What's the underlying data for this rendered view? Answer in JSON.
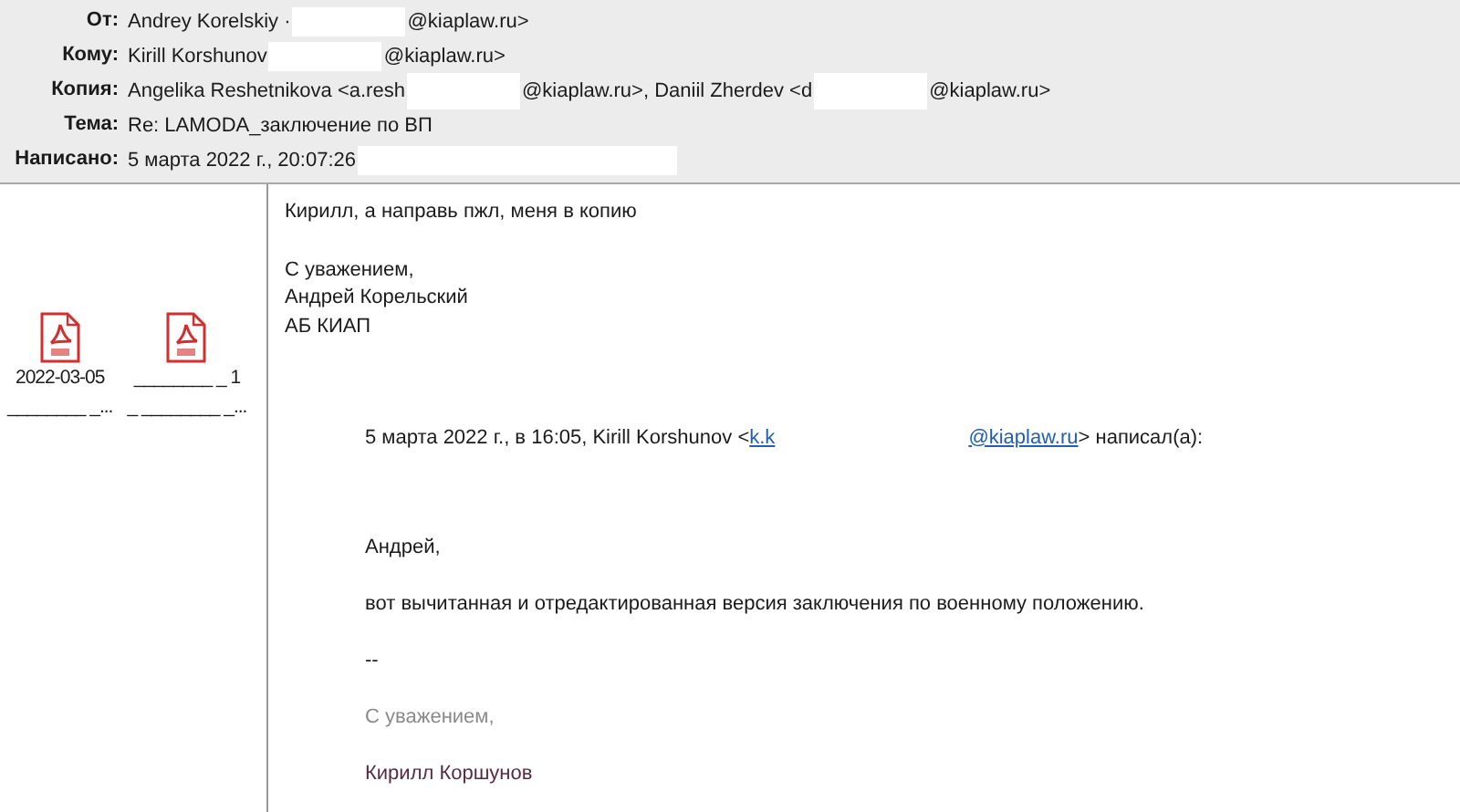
{
  "header": {
    "fields": [
      {
        "label": "От:",
        "parts": [
          {
            "kind": "text",
            "text": "Andrey Korelskiy ·"
          },
          {
            "kind": "redaction"
          },
          {
            "kind": "text",
            "text": "@kiaplaw.ru>"
          }
        ]
      },
      {
        "label": "Кому:",
        "parts": [
          {
            "kind": "text",
            "text": "Kirill Korshunov"
          },
          {
            "kind": "redaction"
          },
          {
            "kind": "text",
            "text": "@kiaplaw.ru>"
          }
        ]
      },
      {
        "label": "Копия:",
        "parts": [
          {
            "kind": "text",
            "text": "Angelika Reshetnikova <a.resh"
          },
          {
            "kind": "redaction"
          },
          {
            "kind": "text",
            "text": "@kiaplaw.ru>, Daniil Zherdev <d"
          },
          {
            "kind": "redaction"
          },
          {
            "kind": "text",
            "text": "@kiaplaw.ru>"
          }
        ]
      },
      {
        "label": "Тема:",
        "parts": [
          {
            "kind": "text",
            "text": "Re: LAMODA_заключение по ВП"
          }
        ]
      },
      {
        "label": "Написано:",
        "parts": [
          {
            "kind": "text",
            "text": "5 марта 2022 г., 20:07:26"
          },
          {
            "kind": "redaction"
          }
        ]
      }
    ]
  },
  "attachments": [
    {
      "name_lines": [
        "2022-03-05",
        "________ _..."
      ]
    },
    {
      "name_lines": [
        "________ _ 1",
        "_ ________ _..."
      ]
    }
  ],
  "reply": {
    "paragraphs": [
      [
        "Кирилл, а направь пжл, меня в копию"
      ],
      [
        "С уважением,",
        "Андрей Корельский",
        "АБ КИАП"
      ]
    ]
  },
  "quote": {
    "header_parts": [
      {
        "kind": "text",
        "text": "5 марта 2022 г., в 16:05, Kirill Korshunov <"
      },
      {
        "kind": "link",
        "text": "k.k"
      },
      {
        "kind": "redaction"
      },
      {
        "kind": "link",
        "text": "@kiaplaw.ru"
      },
      {
        "kind": "text",
        "text": "> написал(а):"
      }
    ],
    "paragraphs": [
      {
        "text": "Андрей,",
        "color": "#1a1a1a"
      },
      {
        "text": "вот вычитанная и отредактированная версия заключения по военному положению.",
        "color": "#1a1a1a"
      },
      {
        "text": "--",
        "color": "#1a1a1a"
      },
      {
        "text": "С уважением,",
        "color": "#8a8a8a"
      },
      {
        "text": "Кирилл Коршунов",
        "color": "#5a2a3e"
      }
    ]
  }
}
